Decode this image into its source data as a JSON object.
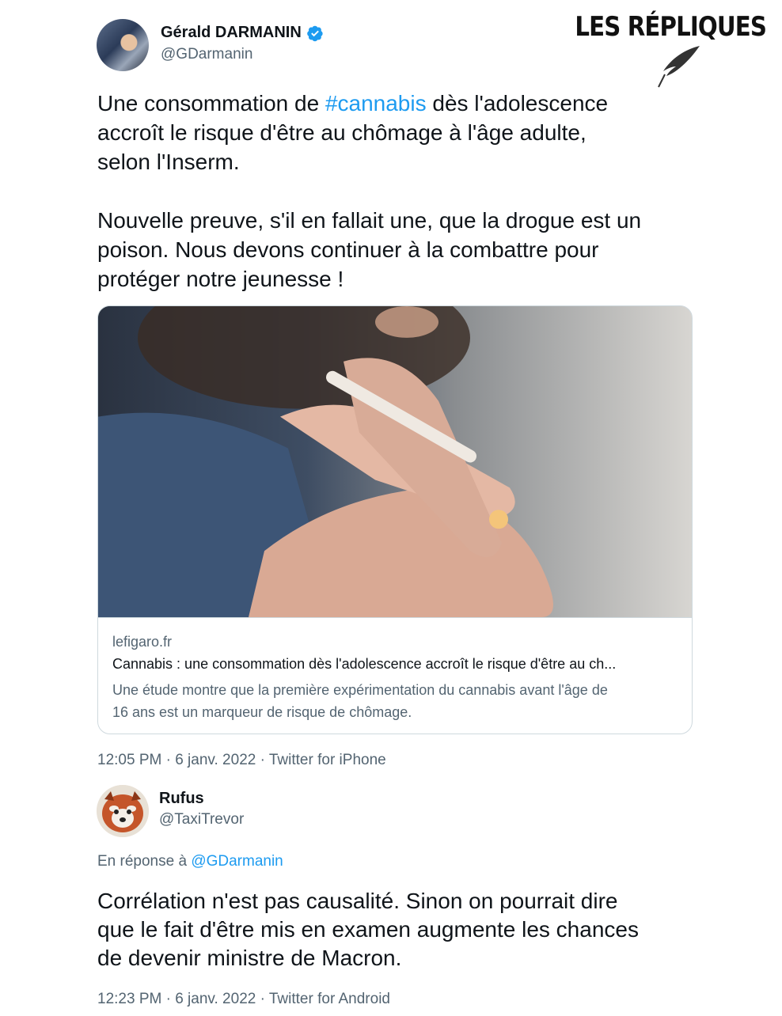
{
  "brand": {
    "label": "LES RÉPLIQUES"
  },
  "tweet": {
    "author_name": "Gérald DARMANIN",
    "author_handle": "@GDarmanin",
    "text_line1_pre": "Une consommation de ",
    "hashtag": "#cannabis",
    "text_line1_post": " dès l'adolescence",
    "text_line2": "accroît le risque d'être au chômage à l'âge adulte,",
    "text_line3": "selon l'Inserm.",
    "text_line4": "Nouvelle preuve, s'il en fallait une, que la drogue est un",
    "text_line5": "poison. Nous devons continuer à la combattre pour",
    "text_line6": "protéger notre jeunesse !",
    "card": {
      "domain": "lefigaro.fr",
      "title": "Cannabis : une consommation dès l'adolescence accroît le risque d'être au ch...",
      "desc_line1": "Une étude montre que la première expérimentation du cannabis avant l'âge de",
      "desc_line2": "16 ans est un marqueur de risque de chômage."
    },
    "meta": "12:05 PM · 6 janv. 2022 · Twitter for iPhone"
  },
  "reply": {
    "author_name": "Rufus",
    "author_handle": "@TaxiTrevor",
    "reply_to_prefix": "En réponse à ",
    "reply_to_mention": "@GDarmanin",
    "text_line1": "Corrélation n'est pas causalité. Sinon on pourrait dire",
    "text_line2": "que le fait d'être mis en examen augmente les chances",
    "text_line3": "de devenir ministre de Macron.",
    "meta": "12:23 PM · 6 janv. 2022 · Twitter for Android"
  },
  "colors": {
    "link": "#1d9bf0",
    "secondary_text": "#536471",
    "primary_text": "#0f1419",
    "border": "#cfd9de"
  }
}
